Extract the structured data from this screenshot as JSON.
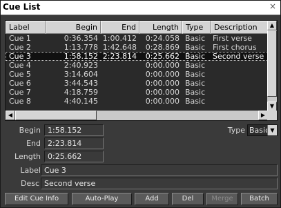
{
  "window": {
    "title": "Cue List",
    "close_label": "×"
  },
  "table": {
    "columns": [
      "Label",
      "Begin",
      "End",
      "Length",
      "Type",
      "Description"
    ],
    "rows": [
      {
        "label": "Cue 1",
        "begin": "0:36.354",
        "end": "1:00.412",
        "length": "0:24.058",
        "type": "Basic",
        "description": "First verse"
      },
      {
        "label": "Cue 2",
        "begin": "1:13.778",
        "end": "1:42.648",
        "length": "0:28.869",
        "type": "Basic",
        "description": "First chorus"
      },
      {
        "label": "Cue 3",
        "begin": "1:58.152",
        "end": "2:23.814",
        "length": "0:25.662",
        "type": "Basic",
        "description": "Second verse"
      },
      {
        "label": "Cue 4",
        "begin": "2:40.923",
        "end": "",
        "length": "0:00.000",
        "type": "Basic",
        "description": ""
      },
      {
        "label": "Cue 5",
        "begin": "3:14.604",
        "end": "",
        "length": "0:00.000",
        "type": "Basic",
        "description": ""
      },
      {
        "label": "Cue 6",
        "begin": "3:44.543",
        "end": "",
        "length": "0:00.000",
        "type": "Basic",
        "description": ""
      },
      {
        "label": "Cue 7",
        "begin": "4:18.759",
        "end": "",
        "length": "0:00.000",
        "type": "Basic",
        "description": ""
      },
      {
        "label": "Cue 8",
        "begin": "4:40.145",
        "end": "",
        "length": "0:00.000",
        "type": "Basic",
        "description": ""
      }
    ],
    "selected_index": 2,
    "scroll_icons": {
      "up": "triangle-up-icon",
      "down": "triangle-down-icon",
      "left": "triangle-left-icon",
      "right": "triangle-right-icon"
    }
  },
  "details": {
    "begin_label": "Begin",
    "begin_value": "1:58.152",
    "end_label": "End",
    "end_value": "2:23.814",
    "length_label": "Length",
    "length_value": "0:25.662",
    "label_label": "Label",
    "label_value": "Cue 3",
    "desc_label": "Desc",
    "desc_value": "Second verse",
    "type_label": "Type",
    "type_value": "Basic"
  },
  "buttons": {
    "edit": "Edit Cue Info",
    "autoplay": "Auto-Play",
    "add": "Add",
    "del": "Del",
    "merge": "Merge",
    "batch": "Batch"
  }
}
